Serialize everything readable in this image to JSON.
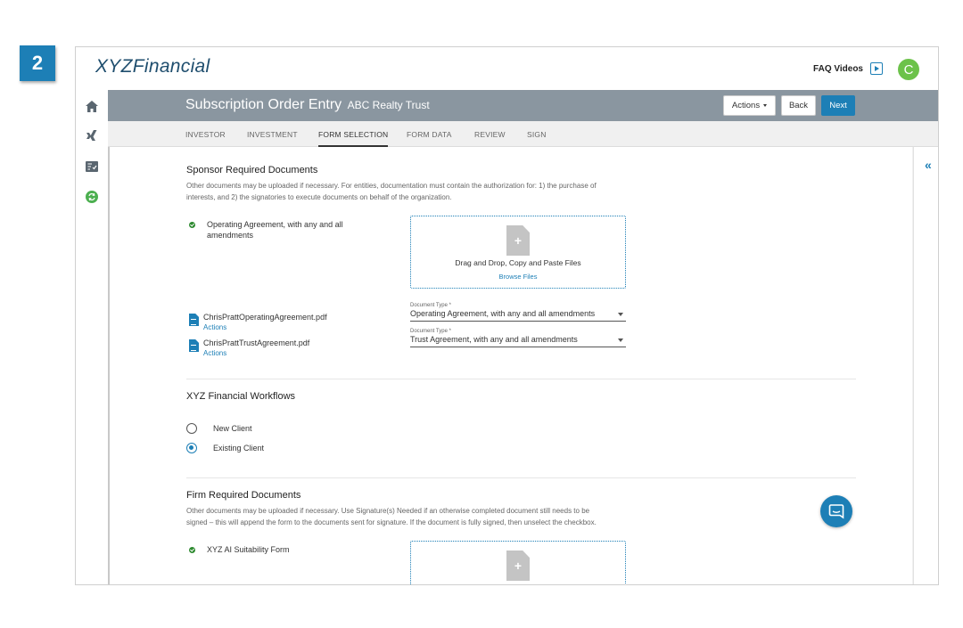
{
  "step_badge": "2",
  "brand": {
    "prefix": "XYZ",
    "name": "Financial"
  },
  "topbar": {
    "faq_label": "FAQ Videos",
    "avatar_initial": "C"
  },
  "header": {
    "title": "Subscription Order Entry",
    "subtitle": "ABC Realty Trust",
    "actions_label": "Actions",
    "back_label": "Back",
    "next_label": "Next"
  },
  "tabs": [
    {
      "label": "INVESTOR",
      "active": false
    },
    {
      "label": "INVESTMENT",
      "active": false
    },
    {
      "label": "FORM SELECTION",
      "active": true
    },
    {
      "label": "FORM DATA",
      "active": false
    },
    {
      "label": "REVIEW",
      "active": false
    },
    {
      "label": "SIGN",
      "active": false
    }
  ],
  "sponsor_docs": {
    "title": "Sponsor Required Documents",
    "help_line1": "Other documents may be uploaded if necessary. For entities, documentation must contain the authorization for: 1) the purchase of",
    "help_line2": "interests, and 2) the signatories to execute documents on behalf of the organization.",
    "requirement_line1": "Operating Agreement, with any and all",
    "requirement_line2": "amendments",
    "dropzone_text": "Drag and Drop, Copy and Paste Files",
    "dropzone_link": "Browse Files",
    "files": [
      {
        "name": "ChrisPrattOperatingAgreement.pdf",
        "actions": "Actions",
        "doc_type_label": "Document Type *",
        "doc_type": "Operating Agreement, with any and all amendments"
      },
      {
        "name": "ChrisPrattTrustAgreement.pdf",
        "actions": "Actions",
        "doc_type_label": "Document Type *",
        "doc_type": "Trust Agreement, with any and all amendments"
      }
    ]
  },
  "workflows": {
    "title": "XYZ Financial Workflows",
    "options": [
      {
        "label": "New Client",
        "selected": false
      },
      {
        "label": "Existing Client",
        "selected": true
      }
    ]
  },
  "firm_docs": {
    "title": "Firm Required Documents",
    "help_line1": "Other documents may be uploaded if necessary. Use Signature(s) Needed if an otherwise completed document still needs to be",
    "help_line2": "signed – this will append the form to the documents sent for signature. If the document is fully signed, then unselect the checkbox.",
    "requirement": "XYZ AI Suitability Form"
  },
  "colors": {
    "accent": "#1d7fb6",
    "header_band": "#8a96a0",
    "avatar": "#6cc24a",
    "check": "#2d8a2f"
  }
}
